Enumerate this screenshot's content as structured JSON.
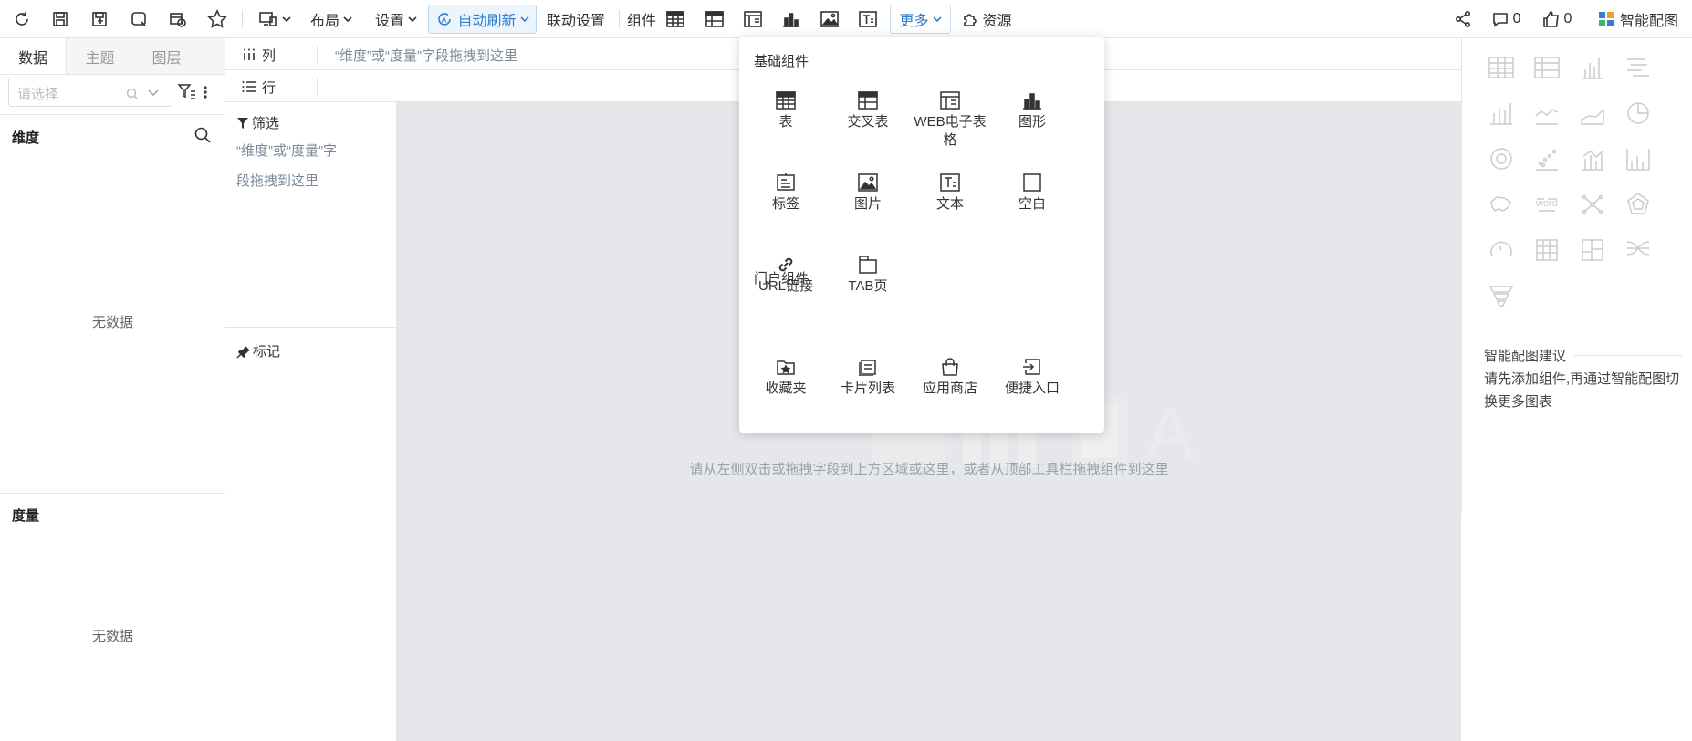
{
  "toolbar": {
    "layout_label": "布局",
    "settings_label": "设置",
    "auto_refresh_label": "自动刷新",
    "linkage_label": "联动设置",
    "component_label": "组件",
    "more_label": "更多",
    "resources_label": "资源",
    "comment_count": "0",
    "like_count": "0",
    "smart_chart_label": "智能配图"
  },
  "left_panel": {
    "tabs": [
      "数据",
      "主题",
      "图层"
    ],
    "search_placeholder": "请选择",
    "dimension_title": "维度",
    "measure_title": "度量",
    "no_data": "无数据"
  },
  "shelves": {
    "column_label": "列",
    "row_label": "行",
    "drop_hint": "“维度”或“度量”字段拖拽到这里"
  },
  "filter_panel": {
    "filter_label": "筛选",
    "filter_hint_line1": "“维度”或“度量”字",
    "filter_hint_line2": "段拖拽到这里",
    "mark_label": "标记"
  },
  "canvas": {
    "hint": "请从左侧双击或拖拽字段到上方区域或这里，或者从顶部工具栏拖拽组件到这里"
  },
  "dropdown": {
    "basic_title": "基础组件",
    "portal_title": "门户组件",
    "basic_items": [
      {
        "label": "表",
        "icon": "table-icon"
      },
      {
        "label": "交叉表",
        "icon": "crosstab-icon"
      },
      {
        "label": "WEB电子表格",
        "icon": "web-sheet-icon"
      },
      {
        "label": "图形",
        "icon": "chart-icon"
      },
      {
        "label": "标签",
        "icon": "label-icon"
      },
      {
        "label": "图片",
        "icon": "image-icon"
      },
      {
        "label": "文本",
        "icon": "text-icon"
      },
      {
        "label": "空白",
        "icon": "blank-icon"
      },
      {
        "label": "URL链接",
        "icon": "link-icon"
      },
      {
        "label": "TAB页",
        "icon": "tab-icon"
      }
    ],
    "portal_items": [
      {
        "label": "收藏夹",
        "icon": "favorites-icon"
      },
      {
        "label": "卡片列表",
        "icon": "card-list-icon"
      },
      {
        "label": "应用商店",
        "icon": "app-store-icon"
      },
      {
        "label": "便捷入口",
        "icon": "shortcut-icon"
      }
    ]
  },
  "right_panel": {
    "suggest_title": "智能配图建议",
    "suggest_text_line1": "请先添加组件,再通过智能配图切",
    "suggest_text_line2": "换更多图表"
  },
  "colors": {
    "accent": "#2f7fcf",
    "canvas_bg": "#e5e7ea",
    "muted_text": "#7a8a9a"
  }
}
